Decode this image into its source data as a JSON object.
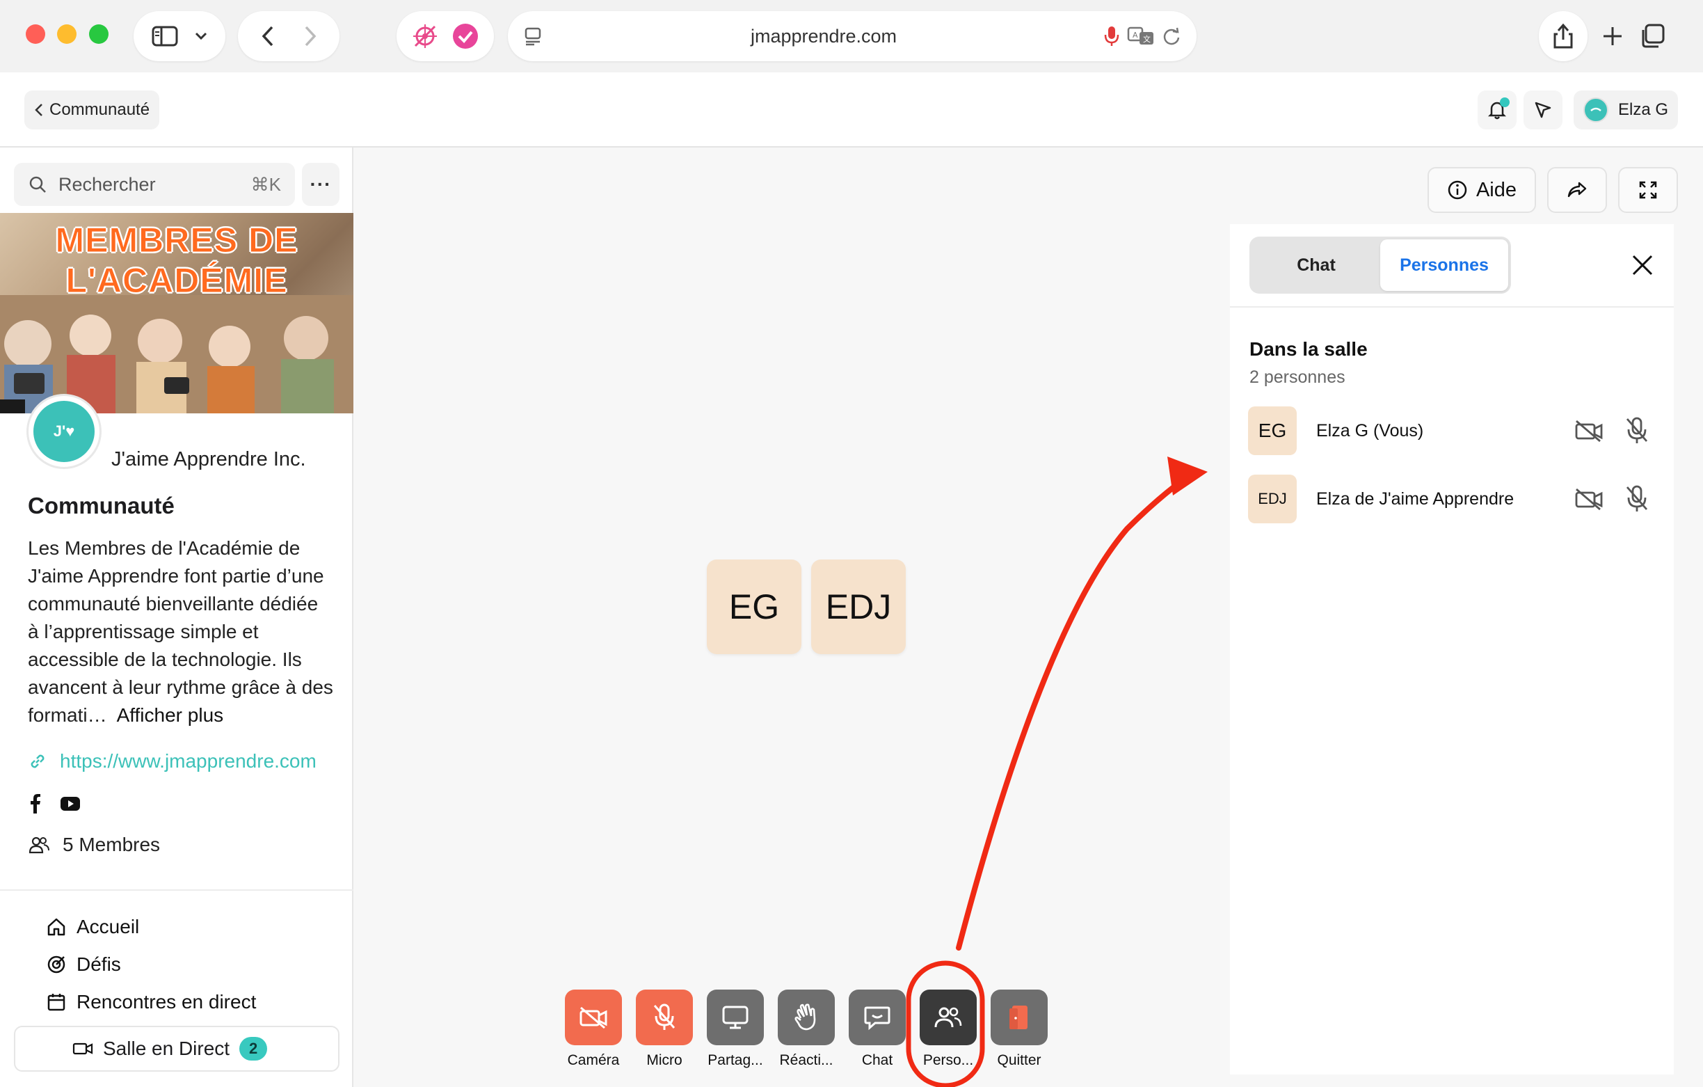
{
  "browser": {
    "url": "jmapprendre.com"
  },
  "appbar": {
    "back_label": "Communauté",
    "user_name": "Elza G"
  },
  "sidebar": {
    "search_placeholder": "Rechercher",
    "search_shortcut": "⌘K",
    "more_label": "···",
    "banner_line1": "MEMBRES DE",
    "banner_line2": "L'ACADÉMIE",
    "logo_text": "J'♥",
    "org_name": "J'aime Apprendre Inc.",
    "community_title": "Communauté",
    "description": "Les Membres de l'Académie de J'aime Apprendre font partie d’une communauté bienveillante dédiée à l’apprentissage simple et accessible de la technologie. Ils avancent à leur rythme grâce à des formati…",
    "show_more": "Afficher plus",
    "link": "https://www.jmapprendre.com",
    "members": "5 Membres",
    "nav": [
      {
        "label": "Accueil"
      },
      {
        "label": "Défis"
      },
      {
        "label": "Rencontres en direct"
      }
    ],
    "live_room": {
      "label": "Salle en Direct",
      "count": "2"
    }
  },
  "room": {
    "tiles": [
      "EG",
      "EDJ"
    ],
    "toolbar": [
      {
        "label": "Caméra"
      },
      {
        "label": "Micro"
      },
      {
        "label": "Partag..."
      },
      {
        "label": "Réacti..."
      },
      {
        "label": "Chat"
      },
      {
        "label": "Perso..."
      },
      {
        "label": "Quitter"
      }
    ],
    "help_label": "Aide"
  },
  "panel": {
    "tabs": [
      "Chat",
      "Personnes"
    ],
    "active_tab": "Personnes",
    "section_title": "Dans la salle",
    "section_count": "2 personnes",
    "people": [
      {
        "initials": "EG",
        "name": "Elza G (Vous)"
      },
      {
        "initials": "EDJ",
        "name": "Elza de J'aime Apprendre"
      }
    ]
  },
  "colors": {
    "accent_teal": "#3cc1b8",
    "danger": "#f26b4e",
    "tab_active": "#1a73e8",
    "annotation_red": "#f02a14"
  }
}
